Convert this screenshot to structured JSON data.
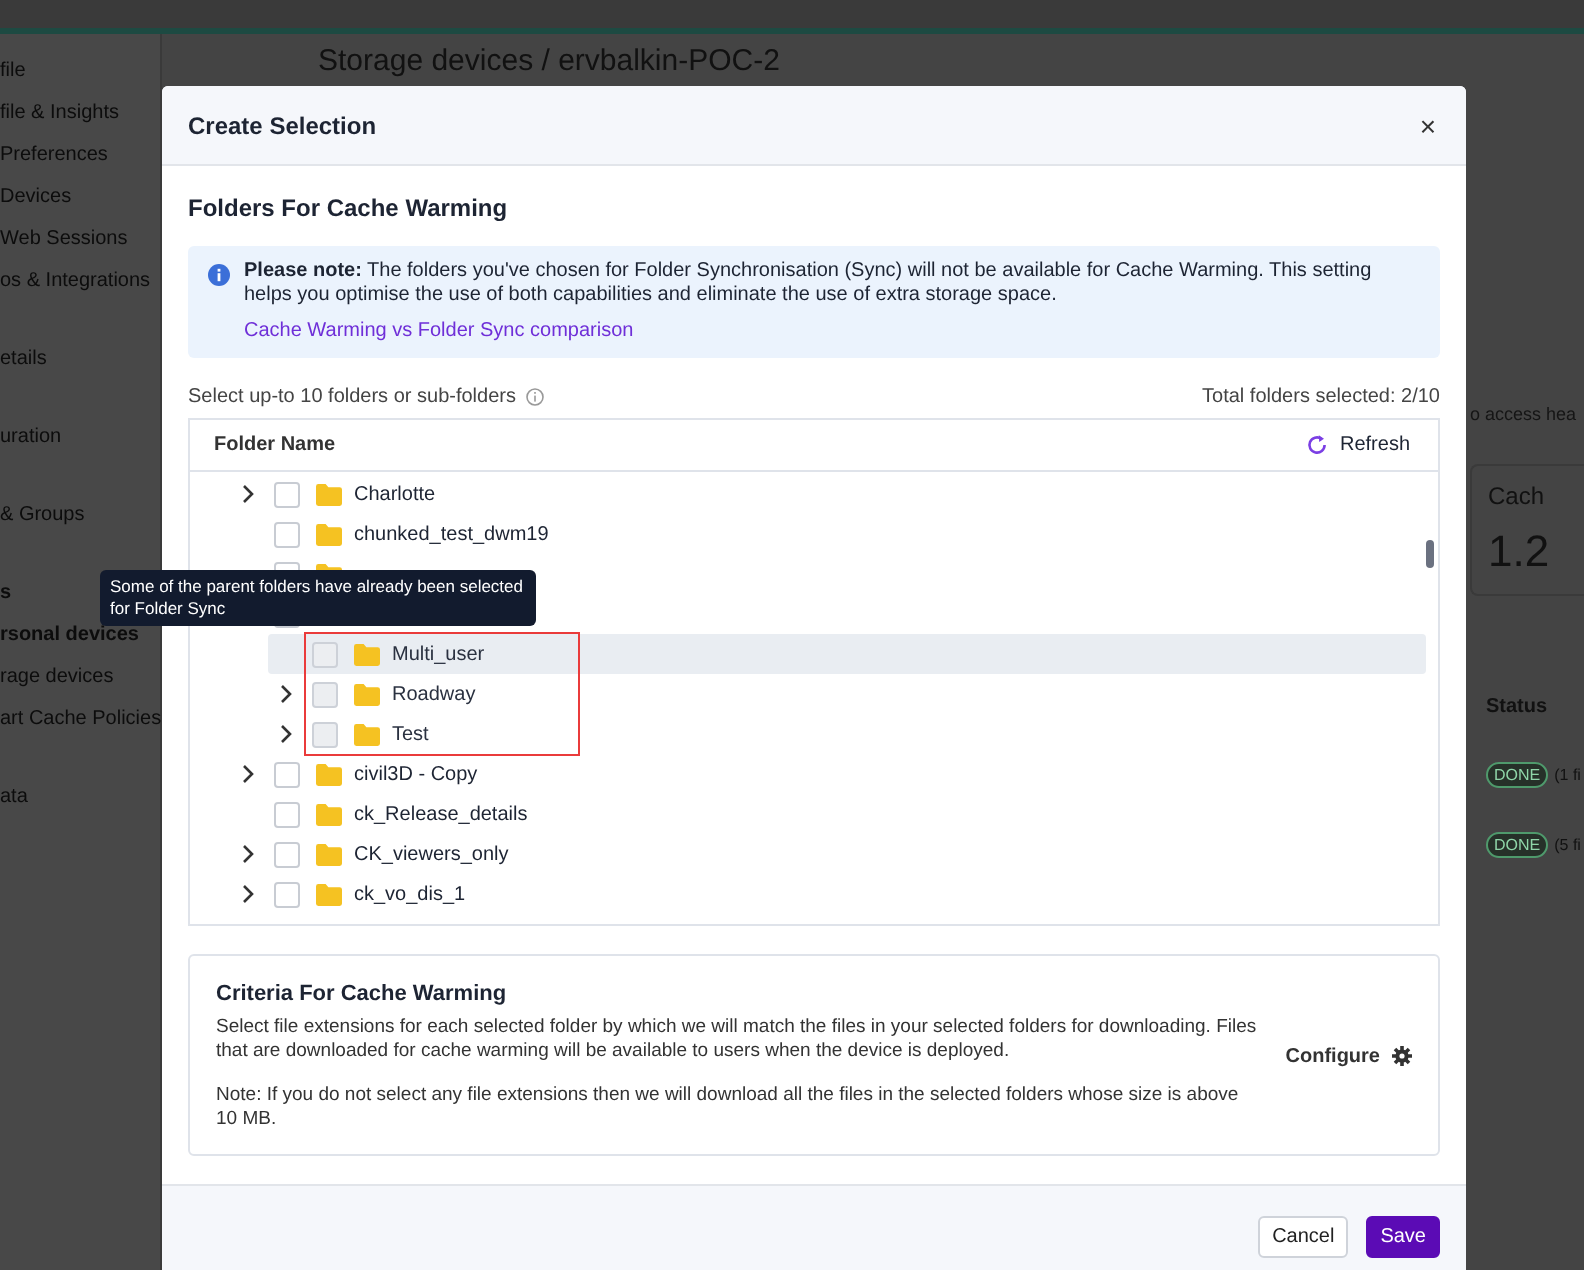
{
  "background": {
    "sidebar_items": [
      "file",
      "file & Insights",
      "Preferences",
      "Devices",
      "Web Sessions",
      "os & Integrations",
      "etails",
      "uration",
      "& Groups",
      "s",
      "rsonal devices",
      "rage devices",
      "art Cache Policies",
      "ata"
    ],
    "breadcrumb": "Storage devices / ervbalkin-POC-2",
    "right_panel": {
      "hint": "o access hea",
      "card_title": "Cach",
      "card_value": "1.2",
      "status_header": "Status",
      "rows": [
        {
          "badge": "DONE",
          "detail": "(1 fi"
        },
        {
          "badge": "DONE",
          "detail": "(5 fi"
        }
      ]
    }
  },
  "dialog": {
    "title": "Create Selection",
    "close": "×",
    "section_title": "Folders For Cache Warming",
    "note": {
      "text": "**Please note:** The folders you've chosen for Folder Synchronisation (Sync) will not be available for Cache Warming. This setting helps you optimise the use of both capabilities and eliminate the use of extra storage space.",
      "link": "Cache Warming vs Folder Sync comparison"
    },
    "select_label": "Select up-to 10 folders or sub-folders",
    "total_selected": "Total folders selected: 2/10",
    "tree": {
      "column": "Folder Name",
      "refresh": "Refresh",
      "tooltip": "Some of the parent folders have already been selected for Folder Sync",
      "items": [
        {
          "name": "Charlotte",
          "has_children": true,
          "expanded": false,
          "checked": false,
          "disabled": false,
          "highlighted": false
        },
        {
          "name": "chunked_test_dwm19",
          "has_children": false,
          "checked": false,
          "disabled": false,
          "highlighted": false
        },
        {
          "has_children": false
        },
        {
          "has_children": true,
          "expanded": true,
          "children_framed": true,
          "children": [
            {
              "name": "Multi_user",
              "has_children": false,
              "checked": false,
              "disabled": true,
              "highlighted": true
            },
            {
              "name": "Roadway",
              "has_children": true,
              "expanded": false,
              "checked": false,
              "disabled": true,
              "highlighted": false
            },
            {
              "name": "Test",
              "has_children": true,
              "expanded": false,
              "checked": false,
              "disabled": true,
              "highlighted": false
            }
          ]
        },
        {
          "name": "civil3D - Copy",
          "has_children": true,
          "expanded": false,
          "checked": false,
          "disabled": false,
          "highlighted": false
        },
        {
          "name": "ck_Release_details",
          "has_children": false,
          "checked": false,
          "disabled": false,
          "highlighted": false
        },
        {
          "name": "CK_viewers_only",
          "has_children": true,
          "expanded": false,
          "checked": false,
          "disabled": false,
          "highlighted": false
        },
        {
          "name": "ck_vo_dis_1",
          "has_children": true,
          "expanded": false,
          "checked": false,
          "disabled": false,
          "highlighted": false
        }
      ]
    },
    "criteria": {
      "title": "Criteria For Cache Warming",
      "description": "Select file extensions for each selected folder by which we will match the files in your selected folders for downloading. Files that are downloaded for cache warming will be available to users when the device is deployed.",
      "note": "Note: If you do not select any file extensions then we will download all the files in the selected folders whose size is above 10 MB.",
      "configure": "Configure"
    },
    "buttons": [
      {
        "label": "Cancel",
        "kind": "secondary"
      },
      {
        "label": "Save",
        "kind": "primary"
      }
    ]
  }
}
